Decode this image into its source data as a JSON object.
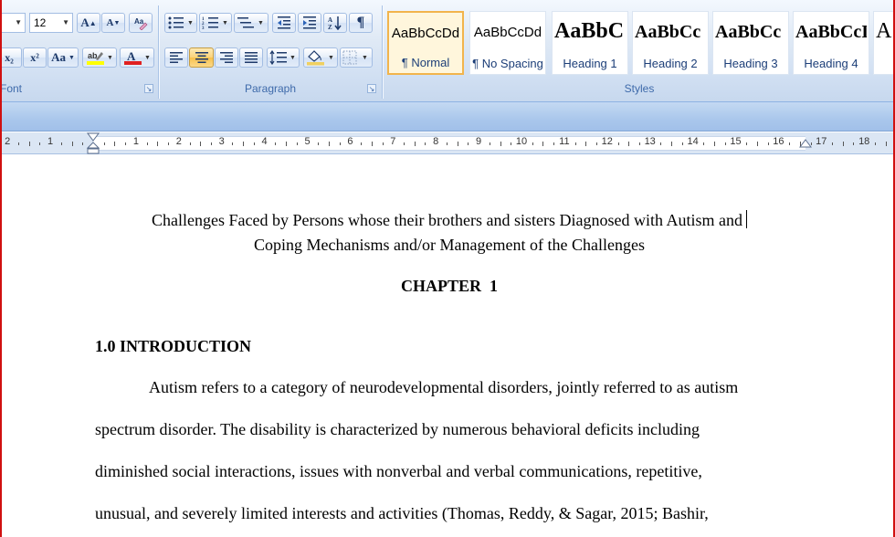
{
  "ribbon": {
    "font_group": {
      "label": "Font",
      "size_value": "12",
      "grow_glyph": "A",
      "shrink_glyph": "A",
      "subscript_label": "x₂",
      "superscript_label": "x²",
      "change_case_label": "Aa",
      "font_color_glyph": "A",
      "font_color": "#e02020",
      "highlight_color": "#ffff00"
    },
    "paragraph_group": {
      "label": "Paragraph",
      "show_marks_glyph": "¶"
    },
    "styles_group": {
      "label": "Styles",
      "tiles": [
        {
          "sample": "AaBbCcDd",
          "name": "¶ Normal"
        },
        {
          "sample": "AaBbCcDd",
          "name": "¶ No Spacing"
        },
        {
          "sample": "AaBbC",
          "name": "Heading 1"
        },
        {
          "sample": "AaBbCc",
          "name": "Heading 2"
        },
        {
          "sample": "AaBbCc",
          "name": "Heading 3"
        },
        {
          "sample": "AaBbCcI",
          "name": "Heading 4"
        },
        {
          "sample": "A",
          "name": ""
        }
      ]
    }
  },
  "ruler": {
    "left_numbers": [
      "2",
      "1"
    ],
    "right_numbers": [
      "1",
      "2",
      "3",
      "4",
      "5",
      "6",
      "7",
      "8",
      "9",
      "10",
      "11",
      "12",
      "13",
      "14",
      "15",
      "16",
      "17",
      "18"
    ]
  },
  "document": {
    "title_line1": "Challenges Faced by Persons whose their brothers and sisters Diagnosed with Autism and",
    "title_line2": "Coping Mechanisms and/or Management of the Challenges",
    "chapter": "CHAPTER  1",
    "section_heading": "1.0 INTRODUCTION",
    "paragraph_lines": [
      "Autism refers to a category of neurodevelopmental disorders, jointly referred to as autism",
      "spectrum disorder. The disability is characterized by numerous behavioral deficits including",
      "diminished social interactions, issues with nonverbal and verbal communications, repetitive,",
      "unusual, and severely limited interests and activities (Thomas, Reddy, & Sagar, 2015; Bashir,"
    ]
  }
}
